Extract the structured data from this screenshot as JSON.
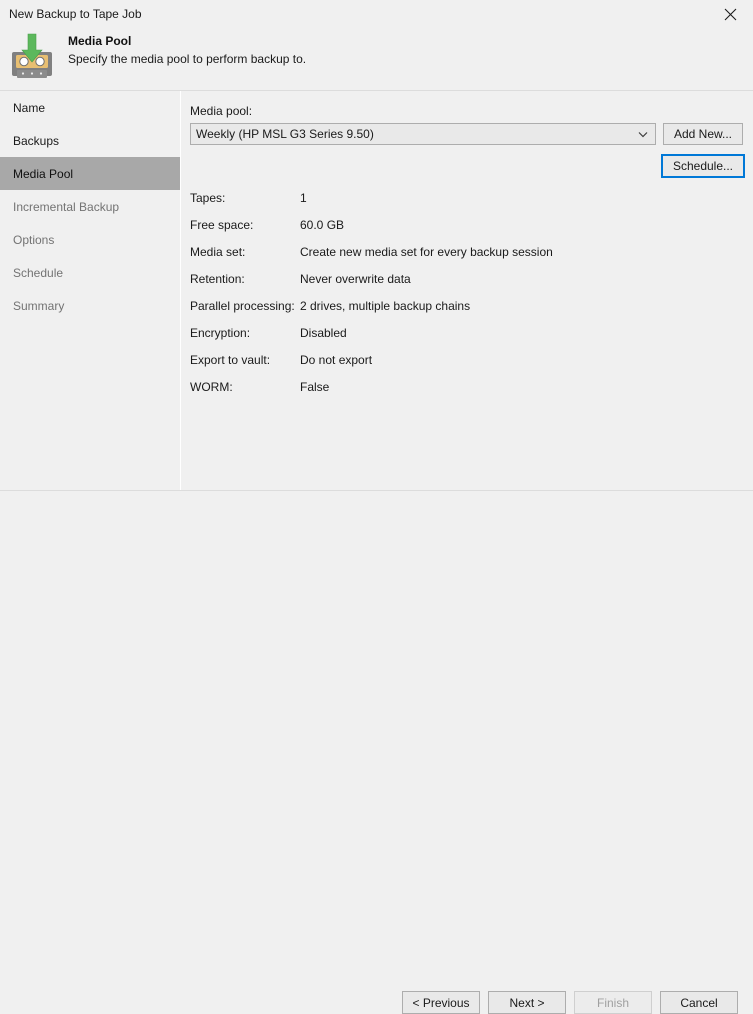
{
  "window": {
    "title": "New Backup to Tape Job",
    "close_icon": "close-icon"
  },
  "header": {
    "icon": "tape-backup-icon",
    "title": "Media Pool",
    "subtitle": "Specify the media pool to perform backup to."
  },
  "sidebar": {
    "items": [
      {
        "label": "Name",
        "state": "visited"
      },
      {
        "label": "Backups",
        "state": "visited"
      },
      {
        "label": "Media Pool",
        "state": "selected"
      },
      {
        "label": "Incremental Backup",
        "state": "pending"
      },
      {
        "label": "Options",
        "state": "pending"
      },
      {
        "label": "Schedule",
        "state": "pending"
      },
      {
        "label": "Summary",
        "state": "pending"
      }
    ]
  },
  "main": {
    "media_pool_label": "Media pool:",
    "media_pool_value": "Weekly (HP MSL G3 Series 9.50)",
    "dropdown_icon": "chevron-down-icon",
    "add_new_label": "Add New...",
    "schedule_label": "Schedule...",
    "details": [
      {
        "label": "Tapes:",
        "value": "1"
      },
      {
        "label": "Free space:",
        "value": "60.0 GB"
      },
      {
        "label": "Media set:",
        "value": "Create new media set for every backup session"
      },
      {
        "label": "Retention:",
        "value": "Never overwrite data"
      },
      {
        "label": "Parallel processing:",
        "value": "2 drives, multiple backup chains"
      },
      {
        "label": "Encryption:",
        "value": "Disabled"
      },
      {
        "label": "Export to vault:",
        "value": "Do not export"
      },
      {
        "label": "WORM:",
        "value": "False"
      }
    ]
  },
  "footer": {
    "previous_label": "< Previous",
    "next_label": "Next >",
    "finish_label": "Finish",
    "cancel_label": "Cancel"
  },
  "colors": {
    "window_background": "#f0f0f0",
    "selected_nav": "#a8a8a8",
    "focus_border": "#0078d7",
    "button_face": "#e9e9e9",
    "button_border": "#adadad",
    "disabled_text": "#a0a0a0",
    "pending_text": "#737373",
    "icon_green": "#4caf50",
    "icon_tan": "#e8bf72",
    "icon_gray": "#808080"
  }
}
